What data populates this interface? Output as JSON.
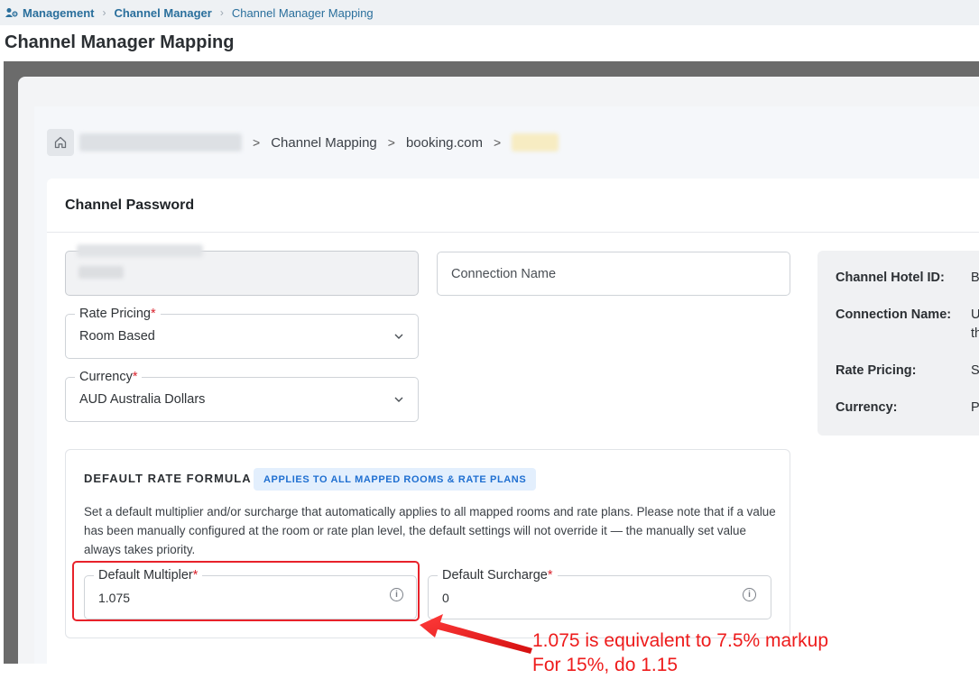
{
  "top_breadcrumb": {
    "items": [
      "Management",
      "Channel Manager",
      "Channel Manager Mapping"
    ]
  },
  "page_title": "Channel Manager Mapping",
  "inner_breadcrumb": {
    "items": [
      "Channel Mapping",
      "booking.com"
    ]
  },
  "card": {
    "title": "Channel Password"
  },
  "form": {
    "connection_name_placeholder": "Connection Name",
    "rate_pricing": {
      "label": "Rate Pricing",
      "required": "*",
      "value": "Room Based"
    },
    "currency": {
      "label": "Currency",
      "required": "*",
      "value": "AUD Australia Dollars"
    }
  },
  "info_panel": {
    "rows": [
      {
        "label": "Channel Hotel ID:",
        "value": "B"
      },
      {
        "label": "Connection Name:",
        "value": "U",
        "value2": "th"
      },
      {
        "label": "Rate Pricing:",
        "value": "S"
      },
      {
        "label": "Currency:",
        "value": "P"
      }
    ]
  },
  "formula": {
    "title": "DEFAULT RATE FORMULA",
    "badge": "APPLIES TO ALL MAPPED ROOMS & RATE PLANS",
    "description": "Set a default multiplier and/or surcharge that automatically applies to all mapped rooms and rate plans. Please note that if a value has been manually configured at the room or rate plan level, the default settings will not override it — the manually set value always takes priority.",
    "multiplier": {
      "label": "Default Multipler",
      "required": "*",
      "value": "1.075"
    },
    "surcharge": {
      "label": "Default Surcharge",
      "required": "*",
      "value": "0"
    },
    "info_glyph": "i"
  },
  "annotation": {
    "line1": "1.075 is equivalent to 7.5% markup",
    "line2": "For 15%, do 1.15"
  },
  "colors": {
    "accent_blue": "#2a6f9c",
    "badge_blue": "#1f6fd1",
    "annotation_red": "#ee1c1c"
  }
}
